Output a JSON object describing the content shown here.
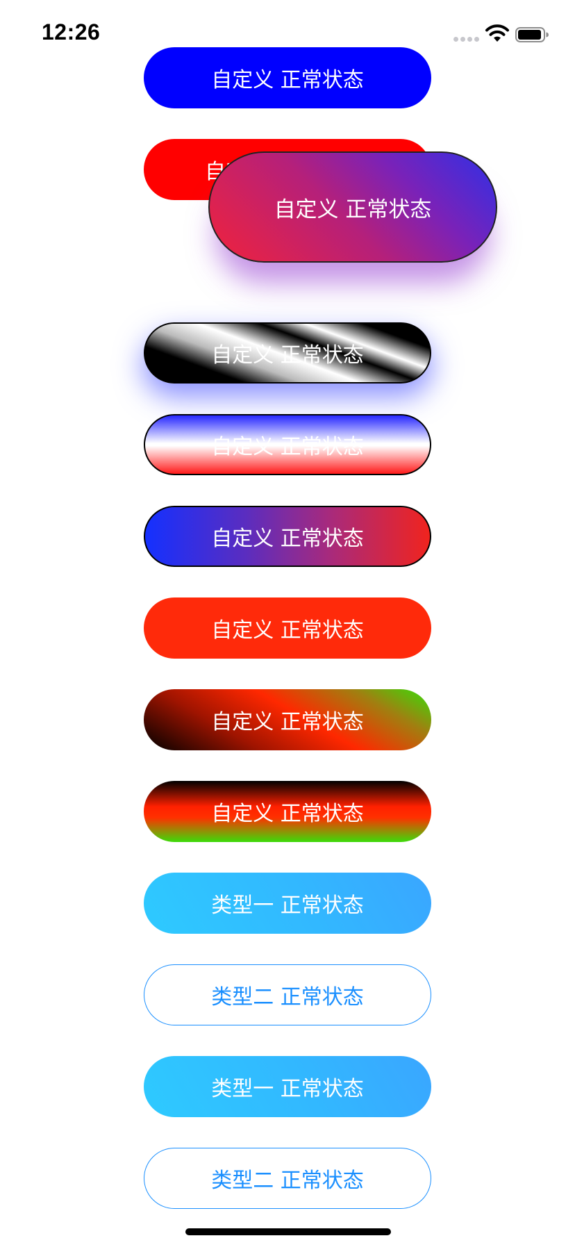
{
  "status_bar": {
    "time": "12:26"
  },
  "buttons": {
    "custom_blue": "自定义 正常状态",
    "custom_red": "自定义 正常状态",
    "custom_gradient_shadow": "自定义 正常状态",
    "custom_black_white": "自定义 正常状态",
    "custom_blue_white_red": "自定义 正常状态",
    "custom_blue_red": "自定义 正常状态",
    "custom_orange": "自定义 正常状态",
    "custom_black_red_green_diag": "自定义 正常状态",
    "custom_black_red_green_vert": "自定义 正常状态",
    "type_one_1": "类型一 正常状态",
    "type_two_1": "类型二 正常状态",
    "type_one_2": "类型一 正常状态",
    "type_two_2": "类型二 正常状态"
  },
  "colors": {
    "primary_blue": "#0000ff",
    "primary_red": "#ff0000",
    "orange_red": "#ff2a0a",
    "sky_blue": "#32b8ff",
    "outline_blue": "#1a8fff",
    "green": "#36e00a",
    "purple_shadow": "#9632d2"
  },
  "icons": {
    "signal": "cellular-signal-icon",
    "wifi": "wifi-icon",
    "battery": "battery-icon"
  }
}
